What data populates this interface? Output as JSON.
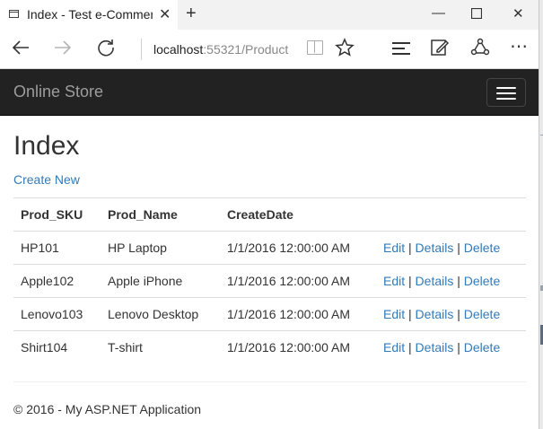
{
  "browser": {
    "tab_title": "Index - Test e-Commerc",
    "url_host": "localhost",
    "url_rest": ":55321/Product"
  },
  "site": {
    "brand": "Online Store"
  },
  "page": {
    "title": "Index",
    "create_link": "Create New"
  },
  "table": {
    "headers": [
      "Prod_SKU",
      "Prod_Name",
      "CreateDate"
    ],
    "rows": [
      {
        "sku": "HP101",
        "name": "HP Laptop",
        "date": "1/1/2016 12:00:00 AM"
      },
      {
        "sku": "Apple102",
        "name": "Apple iPhone",
        "date": "1/1/2016 12:00:00 AM"
      },
      {
        "sku": "Lenovo103",
        "name": "Lenovo Desktop",
        "date": "1/1/2016 12:00:00 AM"
      },
      {
        "sku": "Shirt104",
        "name": "T-shirt",
        "date": "1/1/2016 12:00:00 AM"
      }
    ],
    "actions": {
      "edit": "Edit",
      "details": "Details",
      "delete": "Delete",
      "separator": "|"
    }
  },
  "footer": {
    "text": "© 2016 - My ASP.NET Application"
  },
  "colors": {
    "navbar_bg": "#222222",
    "link": "#337ab7",
    "brand": "#9d9d9d"
  }
}
